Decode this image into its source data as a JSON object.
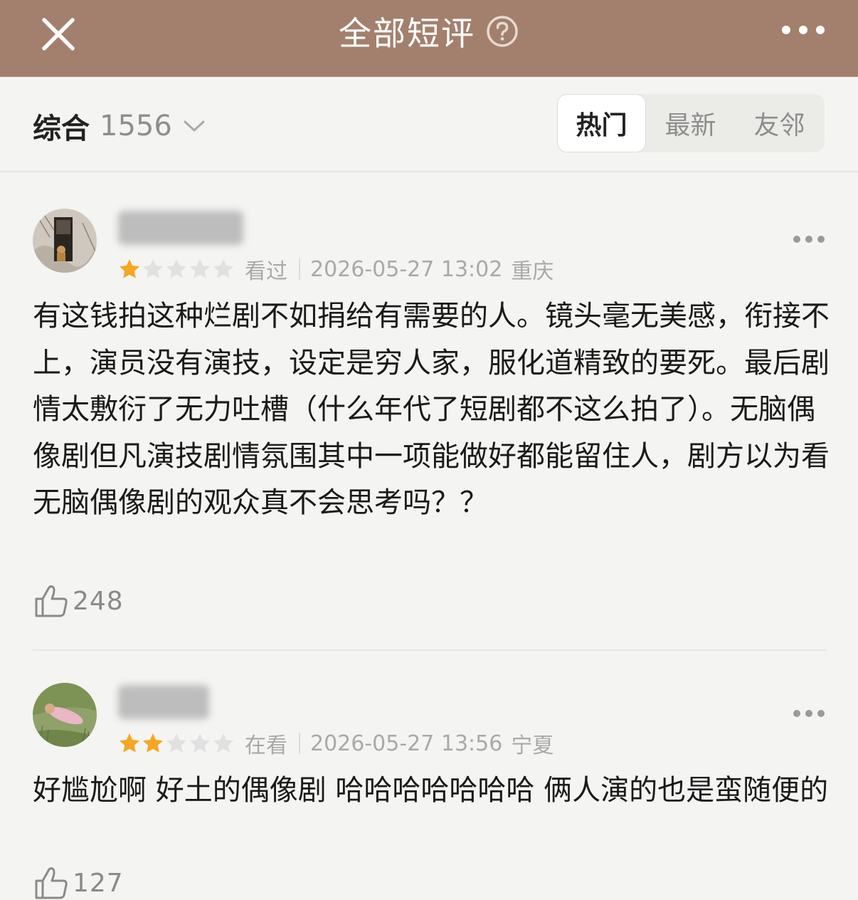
{
  "header": {
    "title": "全部短评",
    "close_icon": "close-icon",
    "help_icon": "help-icon",
    "more_icon": "more-icon"
  },
  "filter": {
    "sort_label": "综合",
    "sort_count": "1556",
    "tabs": [
      {
        "label": "热门",
        "active": true
      },
      {
        "label": "最新",
        "active": false
      },
      {
        "label": "友邻",
        "active": false
      }
    ]
  },
  "colors": {
    "header_bg": "#a3806d",
    "star_on": "#f5a623",
    "star_off": "#e1e1e1"
  },
  "reviews": [
    {
      "rating": 1,
      "max_rating": 5,
      "status": "看过",
      "datetime": "2026-05-27 13:02",
      "location": "重庆",
      "text": "有这钱拍这种烂剧不如捐给有需要的人。镜头毫无美感，衔接不上，演员没有演技，设定是穷人家，服化道精致的要死。最后剧情太敷衍了无力吐槽（什么年代了短剧都不这么拍了）。无脑偶像剧但凡演技剧情氛围其中一项能做好都能留住人，剧方以为看无脑偶像剧的观众真不会思考吗？？",
      "likes": "248"
    },
    {
      "rating": 2,
      "max_rating": 5,
      "status": "在看",
      "datetime": "2026-05-27 13:56",
      "location": "宁夏",
      "text": "好尴尬啊  好土的偶像剧  哈哈哈哈哈哈哈 俩人演的也是蛮随便的",
      "likes": "127"
    }
  ]
}
